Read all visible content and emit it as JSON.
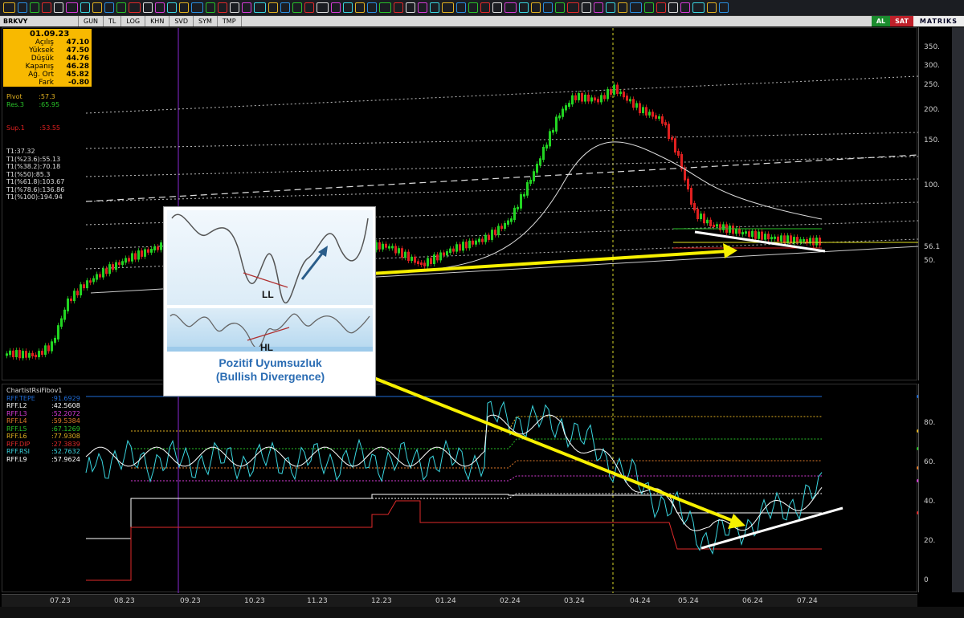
{
  "toolbar": {
    "icon_count": 58
  },
  "tabbar": {
    "symbol": "BRKVY",
    "tabs": [
      "GUN",
      "TL",
      "LOG",
      "KHN",
      "SVD",
      "SYM",
      "TMP"
    ],
    "buy": "AL",
    "sell": "SAT",
    "brand": "MATRIKS"
  },
  "ohlc": {
    "date": "01.09.23",
    "rows": [
      {
        "label": "Açılış",
        "value": "47.10"
      },
      {
        "label": "Yüksek",
        "value": "47.50"
      },
      {
        "label": "Düşük",
        "value": "44.76"
      },
      {
        "label": "Kapanış",
        "value": "46.28"
      },
      {
        "label": "Ağ. Ort",
        "value": "45.82"
      },
      {
        "label": "Fark",
        "value": "-0.80"
      }
    ]
  },
  "pivot": {
    "pivot_label": "Pivot",
    "pivot_value": ":57.3",
    "res_label": "Res.3",
    "res_value": ":65.95",
    "sup_label": "Sup.1",
    "sup_value": ":53.55"
  },
  "fib": [
    "T1:37.32",
    "T1(%23.6):55.13",
    "T1(%38.2):70.18",
    "T1(%50):85.3",
    "T1(%61.8):103.67",
    "T1(%78.6):136.86",
    "T1(%100):194.94"
  ],
  "indicator": {
    "title": "ChartistRsiFibov1",
    "lines": [
      {
        "key": "RFF.TEPE",
        "value": ":91.6929",
        "color": "#1e6bd6"
      },
      {
        "key": "RFF.L2",
        "value": ":42.5608",
        "color": "#ffffff"
      },
      {
        "key": "RFF.L3",
        "value": ":52.2072",
        "color": "#d63bd6"
      },
      {
        "key": "RFF.L4",
        "value": ":59.5384",
        "color": "#e07a2a"
      },
      {
        "key": "RFF.L5",
        "value": ":67.1269",
        "color": "#29c229"
      },
      {
        "key": "RFF.L6",
        "value": ":77.9308",
        "color": "#e0b020"
      },
      {
        "key": "RFF.DIP",
        "value": ":27.3839",
        "color": "#e02a2a"
      },
      {
        "key": "RFF.RSI",
        "value": ":52.7632",
        "color": "#3ad6e0"
      },
      {
        "key": "RFF.L9",
        "value": ":57.9624",
        "color": "#ffffff"
      }
    ]
  },
  "price_axis": [
    "350.",
    "300.",
    "250.",
    "200.",
    "150.",
    "100.",
    "56.1",
    "50."
  ],
  "rsi_axis": [
    "80.",
    "60.",
    "40.",
    "20.",
    "0"
  ],
  "dates": [
    "07.23",
    "08.23",
    "09.23",
    "10.23",
    "11.23",
    "12.23",
    "01.24",
    "02.24",
    "03.24",
    "04.24",
    "05.24",
    "06.24",
    "07.24"
  ],
  "inset": {
    "label_low": "LL",
    "label_high": "HL",
    "caption_1": "Pozitif Uyumsuzluk",
    "caption_2": "(Bullish Divergence)"
  },
  "colors": {
    "up": "#22d422",
    "down": "#e02020",
    "annotation_arrow": "#f7f000",
    "trendline": "#ffffff"
  }
}
